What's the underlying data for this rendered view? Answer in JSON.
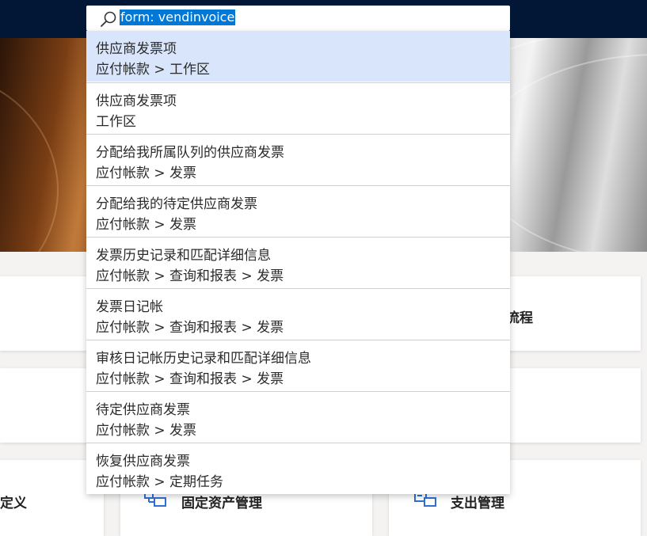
{
  "search": {
    "value": "form: vendinvoice"
  },
  "results": [
    {
      "title": "供应商发票项",
      "path": "应付帐款 > 工作区"
    },
    {
      "title": "供应商发票项",
      "path": "工作区"
    },
    {
      "title": "分配给我所属队列的供应商发票",
      "path": "应付帐款 > 发票"
    },
    {
      "title": "分配给我的待定供应商发票",
      "path": "应付帐款 > 发票"
    },
    {
      "title": "发票历史记录和匹配详细信息",
      "path": "应付帐款 > 查询和报表 > 发票"
    },
    {
      "title": "发票日记帐",
      "path": "应付帐款 > 查询和报表 > 发票"
    },
    {
      "title": "审核日记帐历史记录和匹配详细信息",
      "path": "应付帐款 > 查询和报表 > 发票"
    },
    {
      "title": "待定供应商发票",
      "path": "应付帐款 > 发票"
    },
    {
      "title": "恢复供应商发票",
      "path": "应付帐款 > 定期任务"
    }
  ],
  "tiles": {
    "row1_right_label": "流程",
    "row3_left_label": "定义",
    "row3_mid_label": "固定资产管理",
    "row3_right_label": "支出管理"
  },
  "colors": {
    "top_bar": "#021736",
    "selection_highlight": "#0078d7",
    "first_result_bg": "#d9e5fa",
    "icon_blue": "#2f6fd6"
  },
  "icons": [
    "search-icon",
    "asset-icon",
    "expense-icon"
  ]
}
